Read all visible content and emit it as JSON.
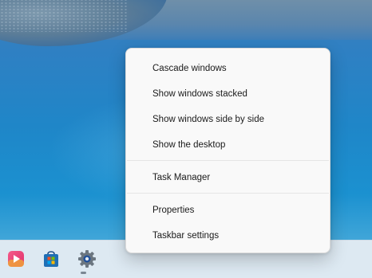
{
  "context_menu": {
    "group1": [
      {
        "label": "Cascade windows"
      },
      {
        "label": "Show windows stacked"
      },
      {
        "label": "Show windows side by side"
      },
      {
        "label": "Show the desktop"
      }
    ],
    "group2": [
      {
        "label": "Task Manager"
      }
    ],
    "group3": [
      {
        "label": "Properties"
      },
      {
        "label": "Taskbar settings"
      }
    ]
  },
  "taskbar": {
    "pinned": [
      {
        "icon": "media-player-icon",
        "color": "#e8436a"
      },
      {
        "icon": "microsoft-store-icon",
        "color": "#1f6fb5"
      },
      {
        "icon": "settings-gear-icon",
        "color": "#5b6670"
      }
    ],
    "active_app_index": 2
  },
  "colors": {
    "menu_background": "#f9f9f9",
    "taskbar_background": "#dde9f2",
    "desktop_water": "#1f86c8"
  }
}
